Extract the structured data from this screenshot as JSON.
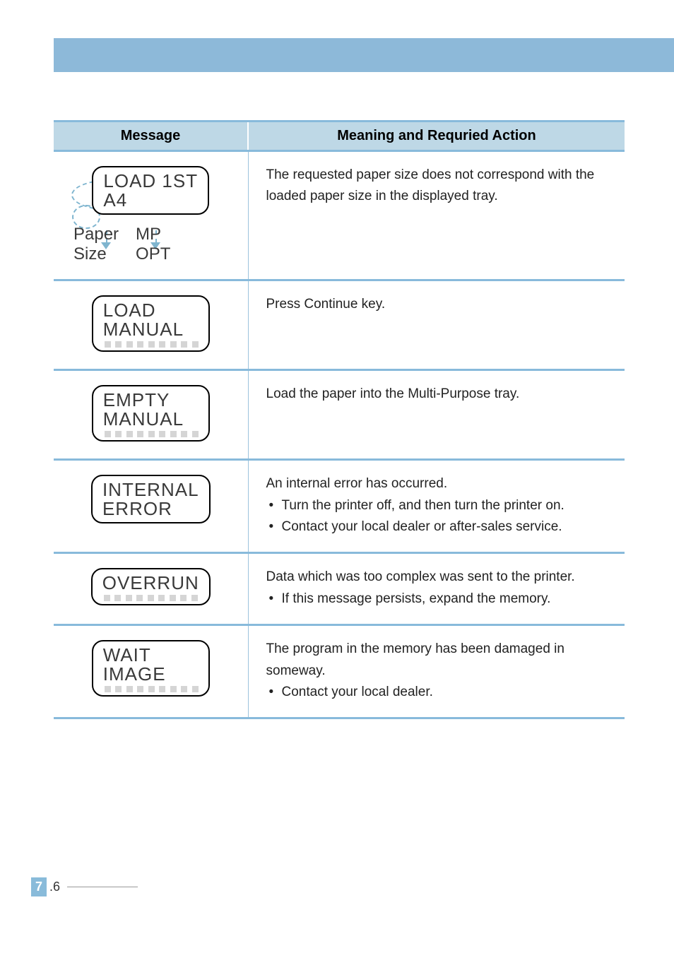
{
  "header": {
    "col1": "Message",
    "col2": "Meaning and Requried Action"
  },
  "rows": [
    {
      "lcd_line1": "LOAD 1ST",
      "lcd_line2": "A4",
      "sub1a": "Paper",
      "sub1b": "Size",
      "sub2a": "MP",
      "sub2b": "OPT",
      "meaning": "The requested paper size does not correspond with the loaded paper size in the displayed tray."
    },
    {
      "lcd_line1": "LOAD",
      "lcd_line2": "MANUAL",
      "meaning": "Press Continue key."
    },
    {
      "lcd_line1": "EMPTY",
      "lcd_line2": "MANUAL",
      "meaning": "Load the paper into the Multi-Purpose tray."
    },
    {
      "lcd_line1": "INTERNAL",
      "lcd_line2": "ERROR",
      "meaning": "An internal error has occurred.",
      "bullets": [
        "Turn the printer off, and then turn the printer on.",
        "Contact your local dealer or after-sales service."
      ]
    },
    {
      "lcd_line1": "OVERRUN",
      "meaning": "Data which was too complex was sent to the printer.",
      "bullets": [
        "If this message persists, expand the memory."
      ]
    },
    {
      "lcd_line1": "WAIT",
      "lcd_line2": "IMAGE",
      "meaning": "The program in the memory has been damaged in someway.",
      "bullets": [
        "Contact your local dealer."
      ]
    }
  ],
  "page": {
    "chapter": "7",
    "num": ".6"
  }
}
